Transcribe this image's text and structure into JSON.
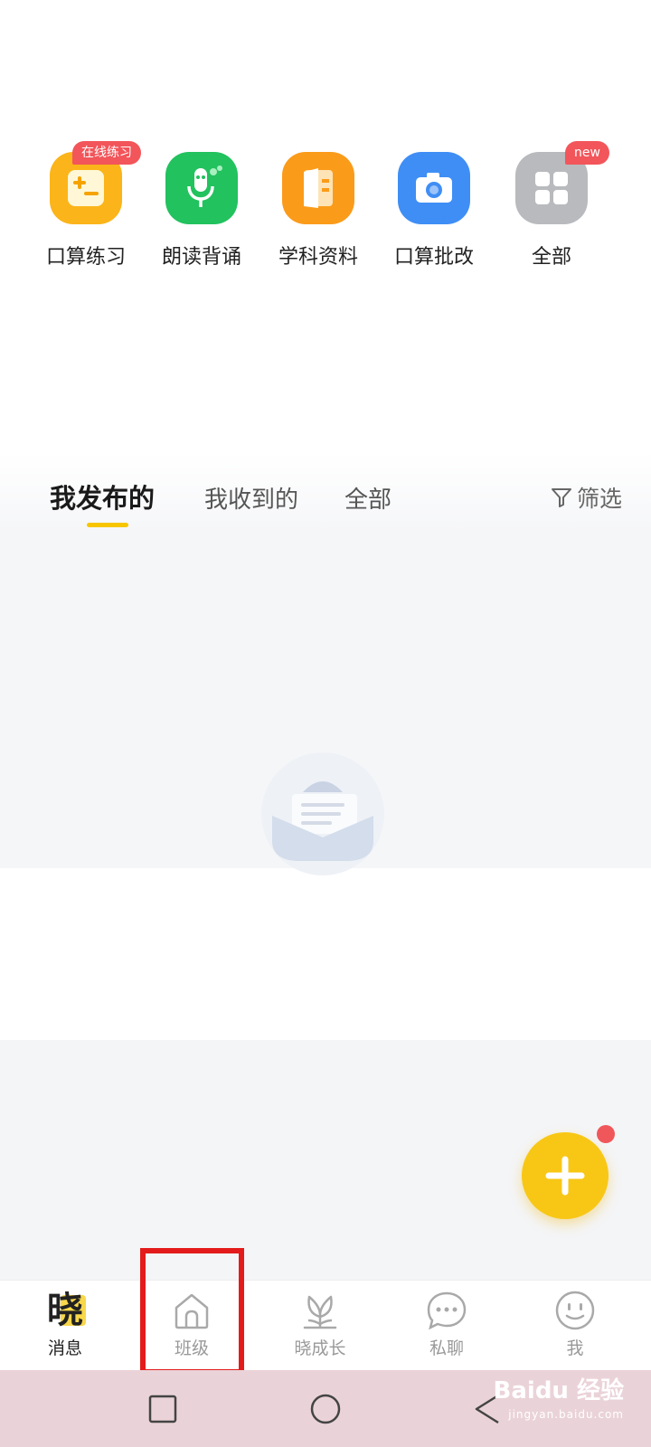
{
  "tools": [
    {
      "label": "口算练习",
      "icon": "worksheet-icon",
      "color": "#fbb419",
      "badge": "在线练习"
    },
    {
      "label": "朗读背诵",
      "icon": "microphone-icon",
      "color": "#22c25e",
      "badge": ""
    },
    {
      "label": "学科资料",
      "icon": "book-icon",
      "color": "#fb9b1a",
      "badge": ""
    },
    {
      "label": "口算批改",
      "icon": "camera-icon",
      "color": "#3f8ef5",
      "badge": ""
    },
    {
      "label": "全部",
      "icon": "grid-icon",
      "color": "#b8babe",
      "badge": "new"
    }
  ],
  "tabs": [
    {
      "label": "我发布的",
      "active": true
    },
    {
      "label": "我收到的",
      "active": false
    },
    {
      "label": "全部",
      "active": false
    }
  ],
  "filter": {
    "label": "筛选",
    "icon": "filter-icon"
  },
  "fab": {
    "icon": "plus-icon",
    "color": "#f8c716",
    "has_dot": true
  },
  "bottom_nav": [
    {
      "label": "消息",
      "icon": "xiao-logo-icon",
      "active": true
    },
    {
      "label": "班级",
      "icon": "house-icon",
      "active": false
    },
    {
      "label": "晓成长",
      "icon": "tulip-icon",
      "active": false
    },
    {
      "label": "私聊",
      "icon": "chat-bubble-icon",
      "active": false
    },
    {
      "label": "我",
      "icon": "smiley-icon",
      "active": false
    }
  ],
  "logo_char": "晓",
  "system_nav": [
    "square-recent-icon",
    "circle-home-icon",
    "triangle-back-icon"
  ],
  "watermark": {
    "main": "Baidu 经验",
    "sub": "jingyan.baidu.com"
  },
  "colors": {
    "accent": "#f7c600",
    "highlight_box": "#e31b1b",
    "badge": "#f2555a"
  }
}
